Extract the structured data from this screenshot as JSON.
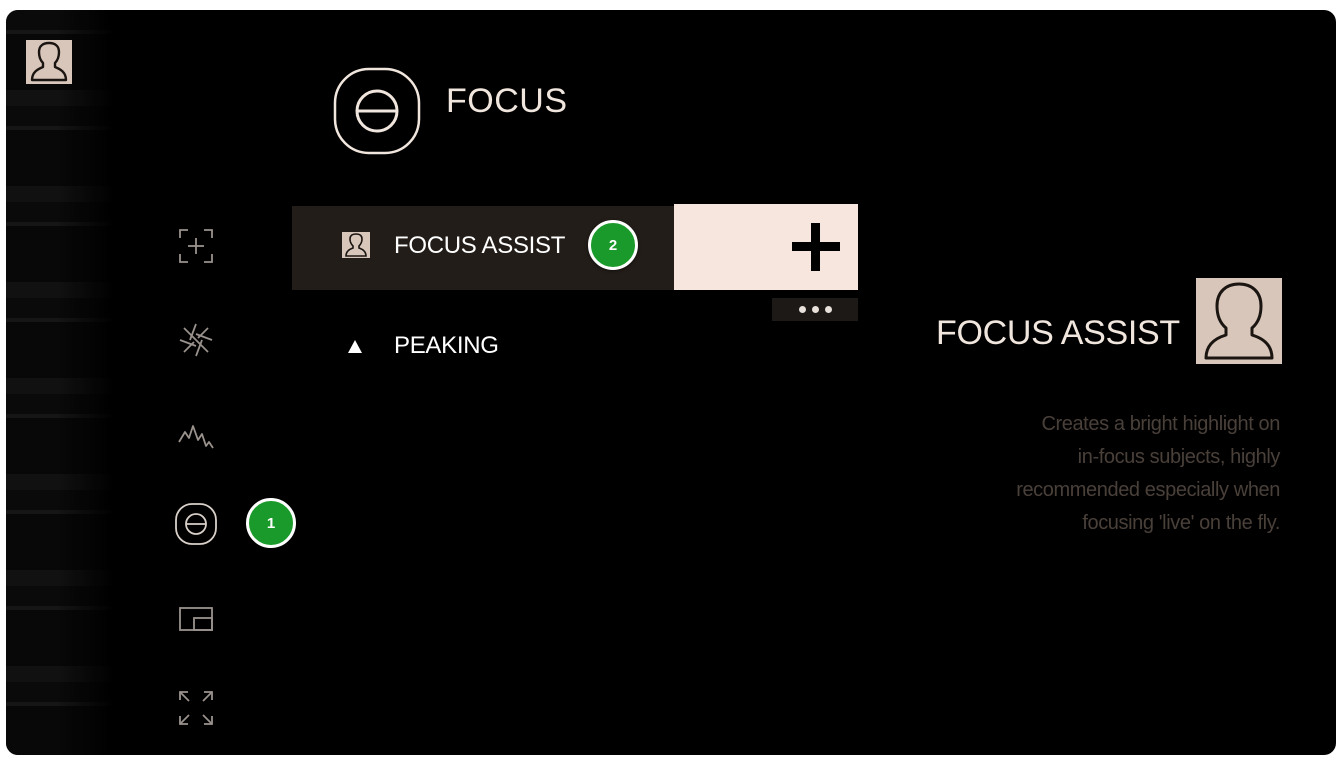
{
  "page": {
    "title": "FOCUS",
    "title_icon": "focus-theta-icon"
  },
  "sidebar": {
    "icons": [
      "profile-icon",
      "crosshair-frame-icon",
      "shutter-icon",
      "waveform-icon",
      "focus-icon",
      "picture-in-picture-icon",
      "expand-icon"
    ],
    "active": "focus-icon"
  },
  "menu": {
    "items": [
      {
        "label": "FOCUS ASSIST",
        "icon": "person-avatar-icon",
        "selected": true
      },
      {
        "label": "PEAKING",
        "icon": "triangle-icon",
        "selected": false
      }
    ],
    "add_icon": "plus-icon",
    "more_icon": "ellipsis-icon"
  },
  "detail": {
    "title": "FOCUS ASSIST",
    "icon": "person-avatar-icon",
    "description_lines": [
      "Creates a bright highlight on",
      "in-focus subjects, highly",
      "recommended especially when",
      "focusing 'live' on the fly."
    ]
  },
  "annotations": [
    {
      "number": "1"
    },
    {
      "number": "2"
    }
  ],
  "colors": {
    "background": "#000000",
    "accent_cream": "#f6e6dd",
    "avatar_tan": "#d8c6ba",
    "badge_green": "#1a9a2a"
  }
}
